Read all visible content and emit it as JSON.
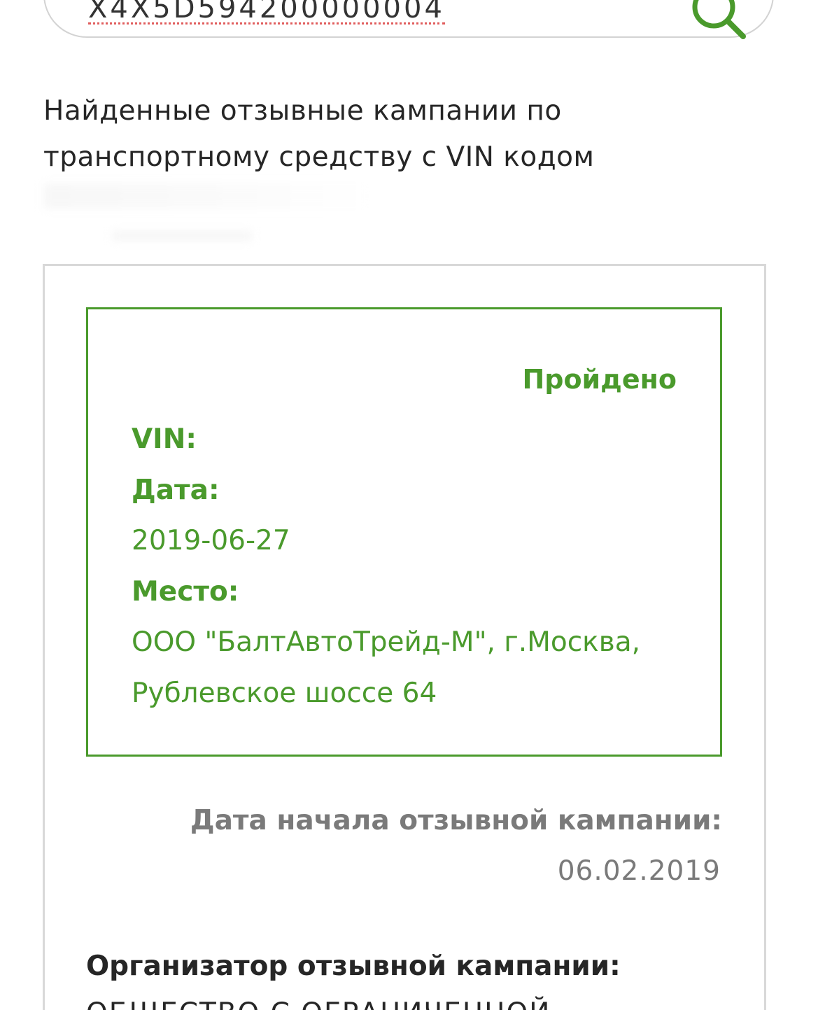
{
  "search": {
    "value": "X4X5D594200000004"
  },
  "results": {
    "intro_text": "Найденные отзывные кампании по транспортному средству с VIN кодом"
  },
  "campaign": {
    "status": "Пройдено",
    "vin_label": "VIN:",
    "date_label": "Дата:",
    "date_value": "2019-06-27",
    "place_label": "Место:",
    "place_value": "ООО \"БалтАвтоТрейд-М\", г.Москва, Рублевское шоссе 64",
    "start_label": "Дата начала отзывной кампании:",
    "start_value": "06.02.2019",
    "organizer_label": "Организатор отзывной кампании:",
    "organizer_value": "ОБЩЕСТВО С ОГРАНИЧЕННОЙ"
  },
  "colors": {
    "accent_green": "#4a9a2c",
    "muted_gray": "#7a7a7a",
    "border_gray": "#d8d8d8"
  }
}
